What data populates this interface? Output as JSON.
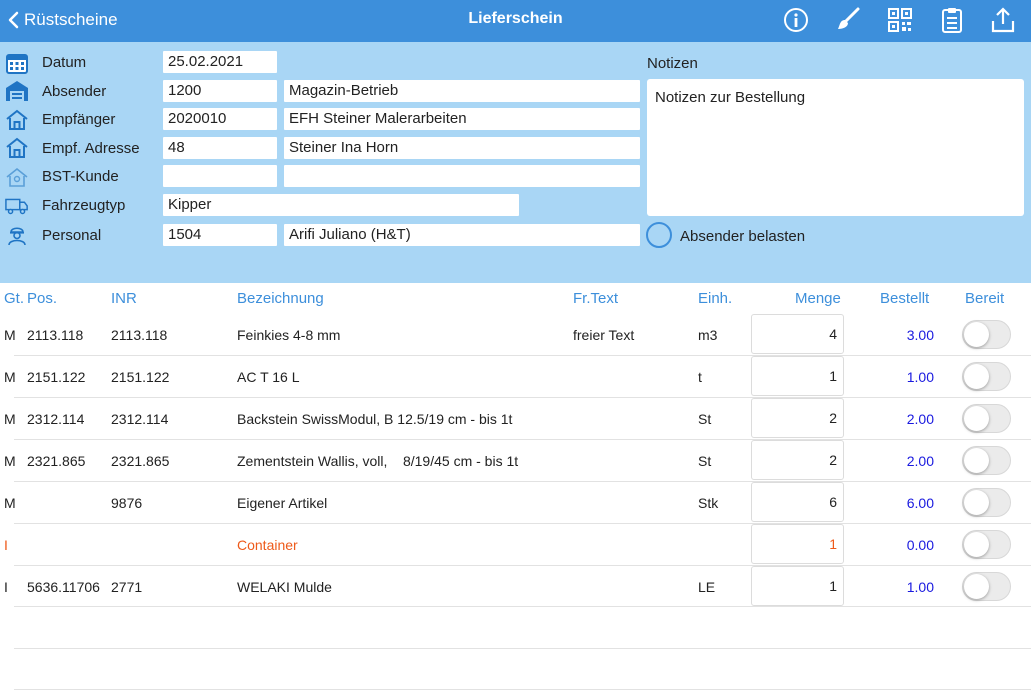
{
  "nav": {
    "back_label": "Rüstscheine",
    "title": "Lieferschein"
  },
  "form": {
    "datum_label": "Datum",
    "datum_value": "25.02.2021",
    "absender_label": "Absender",
    "absender_nr": "1200",
    "absender_name": "Magazin-Betrieb",
    "empfaenger_label": "Empfänger",
    "empfaenger_nr": "2020010",
    "empfaenger_name": "EFH Steiner Malerarbeiten",
    "adresse_label": "Empf. Adresse",
    "adresse_nr": "48",
    "adresse_name": "Steiner Ina Horn",
    "bst_label": "BST-Kunde",
    "bst_nr": "",
    "bst_name": "",
    "fahrzeug_label": "Fahrzeugtyp",
    "fahrzeug_value": "Kipper",
    "personal_label": "Personal",
    "personal_nr": "1504",
    "personal_name": "Arifi Juliano (H&T)",
    "notizen_label": "Notizen",
    "notizen_value": "Notizen zur Bestellung",
    "absender_belasten_label": "Absender belasten"
  },
  "table": {
    "headers": {
      "gt": "Gt.",
      "pos": "Pos.",
      "inr": "INR",
      "bezeichnung": "Bezeichnung",
      "frtext": "Fr.Text",
      "einh": "Einh.",
      "menge": "Menge",
      "bestellt": "Bestellt",
      "bereit": "Bereit"
    },
    "rows": [
      {
        "gt": "M",
        "pos": "2113.118",
        "inr": "2113.118",
        "bez": "Feinkies 4-8 mm",
        "frtext": "freier Text",
        "einh": "m3",
        "menge": "4",
        "bestellt": "3.00"
      },
      {
        "gt": "M",
        "pos": "2151.122",
        "inr": "2151.122",
        "bez": "AC T 16 L",
        "frtext": "",
        "einh": "t",
        "menge": "1",
        "bestellt": "1.00"
      },
      {
        "gt": "M",
        "pos": "2312.114",
        "inr": "2312.114",
        "bez": "Backstein SwissModul, B 12.5/19 cm - bis 1t",
        "frtext": "",
        "einh": "St",
        "menge": "2",
        "bestellt": "2.00"
      },
      {
        "gt": "M",
        "pos": "2321.865",
        "inr": "2321.865",
        "bez": "Zementstein Wallis, voll,    8/19/45 cm - bis 1t",
        "frtext": "",
        "einh": "St",
        "menge": "2",
        "bestellt": "2.00"
      },
      {
        "gt": "M",
        "pos": "",
        "inr": "9876",
        "bez": "Eigener Artikel",
        "frtext": "",
        "einh": "Stk",
        "menge": "6",
        "bestellt": "6.00"
      },
      {
        "gt": "I",
        "pos": "",
        "inr": "",
        "bez": "Container",
        "frtext": "",
        "einh": "",
        "menge": "1",
        "bestellt": "0.00"
      },
      {
        "gt": "I",
        "pos": "5636.11706",
        "inr": "2771",
        "bez": "WELAKI Mulde",
        "frtext": "",
        "einh": "LE",
        "menge": "1",
        "bestellt": "1.00"
      }
    ]
  },
  "colors": {
    "nav_bg": "#3d8fdb",
    "panel_bg": "#a9d6f5",
    "header_text": "#3d8fdb",
    "bestellt_text": "#1a1adf",
    "container_text": "#ee5a1a"
  }
}
